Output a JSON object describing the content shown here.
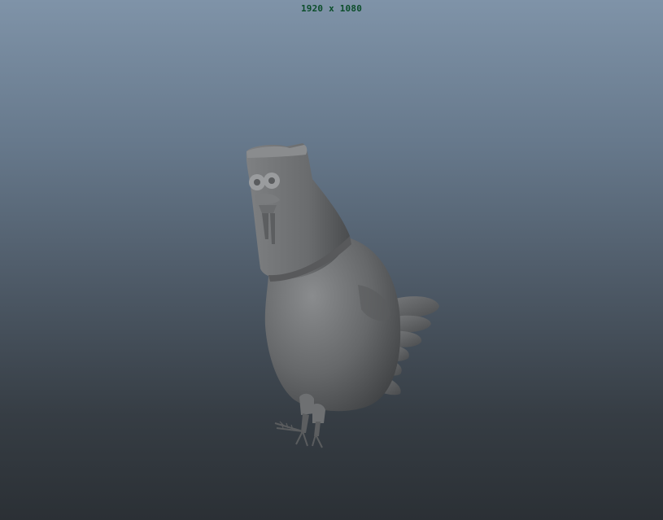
{
  "viewport": {
    "resolution_label": "1920 x 1080",
    "label_color": "#0b4d2a",
    "background_top_color": "#7f93a8",
    "background_bottom_color": "#2b3035"
  },
  "model": {
    "subject_icon": "chicken-3d-model",
    "shading_color": "#6c6e70"
  }
}
